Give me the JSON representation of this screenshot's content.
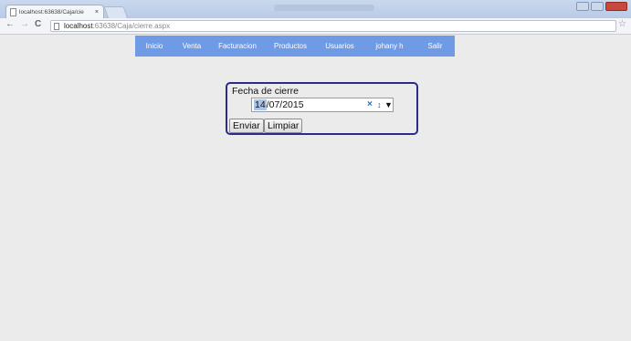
{
  "browser": {
    "tab_title": "localhost:63638/Caja/cie",
    "tab_close": "×",
    "url_host": "localhost",
    "url_rest": ":63638/Caja/cierre.aspx",
    "back": "←",
    "forward": "→",
    "reload": "C",
    "star": "☆"
  },
  "menu": {
    "items": [
      "Inicio",
      "Venta",
      "Facturacion",
      "Productos",
      "Usuarios",
      "johany h",
      "Salir"
    ]
  },
  "form": {
    "label": "Fecha de cierre",
    "date_day": "14",
    "date_rest": "/07/2015",
    "clear": "×",
    "spin": "↕",
    "dropdown": "▼",
    "submit_label": "Enviar",
    "reset_label": "Limpiar"
  },
  "colors": {
    "menu_bg": "#6f9ae6",
    "form_border": "#2b2b8c"
  }
}
